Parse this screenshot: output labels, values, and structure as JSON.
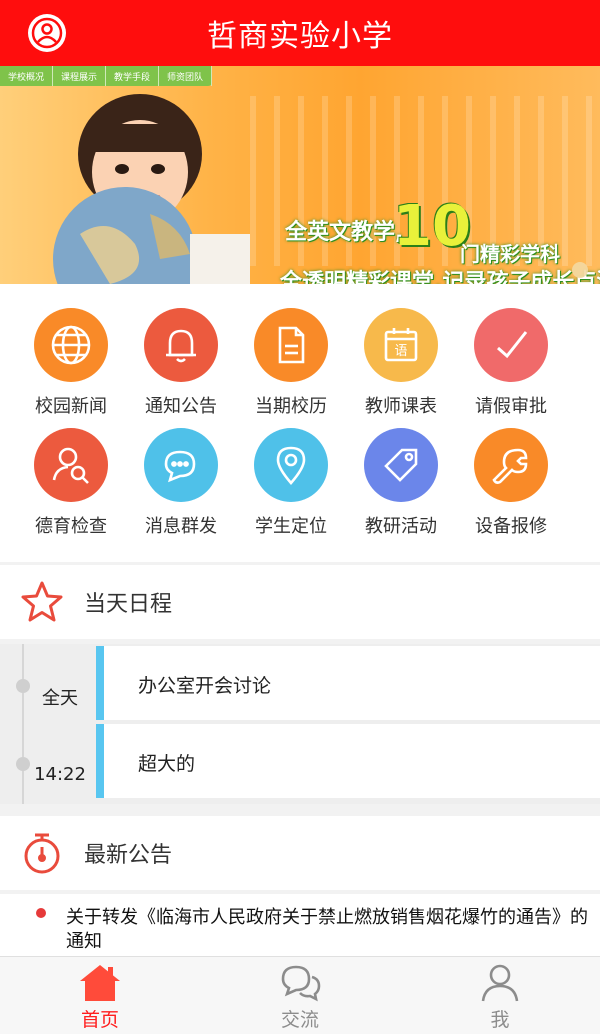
{
  "header": {
    "title": "哲商实验小学",
    "avatar_icon": "user-circle-icon"
  },
  "banner": {
    "tabs": [
      "学校概况",
      "课程展示",
      "教学手段",
      "师资团队"
    ],
    "slogan_prefix": "全英文教学,",
    "slogan_number": "10",
    "slogan_suffix": "门精彩学科",
    "slogan_line2": "全透明精彩课堂,记录孩子成长点滴"
  },
  "grid": {
    "items": [
      {
        "label": "校园新闻",
        "icon": "globe-icon",
        "color": "#f98a28"
      },
      {
        "label": "通知公告",
        "icon": "bell-icon",
        "color": "#ec5a3e"
      },
      {
        "label": "当期校历",
        "icon": "document-icon",
        "color": "#f98a28"
      },
      {
        "label": "教师课表",
        "icon": "calendar-icon",
        "color": "#f7b94b"
      },
      {
        "label": "请假审批",
        "icon": "checkmark-icon",
        "color": "#f06a6a"
      },
      {
        "label": "德育检查",
        "icon": "person-search-icon",
        "color": "#ec5a3e"
      },
      {
        "label": "消息群发",
        "icon": "chat-bubbles-icon",
        "color": "#4fc1e9"
      },
      {
        "label": "学生定位",
        "icon": "location-pin-icon",
        "color": "#4fc1e9"
      },
      {
        "label": "教研活动",
        "icon": "tag-icon",
        "color": "#6b86ea"
      },
      {
        "label": "设备报修",
        "icon": "wrench-icon",
        "color": "#f98a28"
      }
    ]
  },
  "schedule": {
    "title": "当天日程",
    "icon": "star-outline-icon",
    "events": [
      {
        "time": "全天",
        "title": "办公室开会讨论"
      },
      {
        "time": "14:22",
        "title": "超大的"
      }
    ]
  },
  "notices": {
    "title": "最新公告",
    "icon": "stopwatch-icon",
    "items": [
      {
        "text": "关于转发《临海市人民政府关于禁止燃放销售烟花爆竹的通告》的通知"
      }
    ]
  },
  "bottom_nav": {
    "items": [
      {
        "label": "首页",
        "icon": "home-icon",
        "active": true
      },
      {
        "label": "交流",
        "icon": "chat-icon",
        "active": false
      },
      {
        "label": "我",
        "icon": "person-icon",
        "active": false
      }
    ]
  },
  "colors": {
    "header": "#ff0d0d",
    "accent": "#ff1e1e",
    "timeline_bar": "#58c6f0"
  }
}
